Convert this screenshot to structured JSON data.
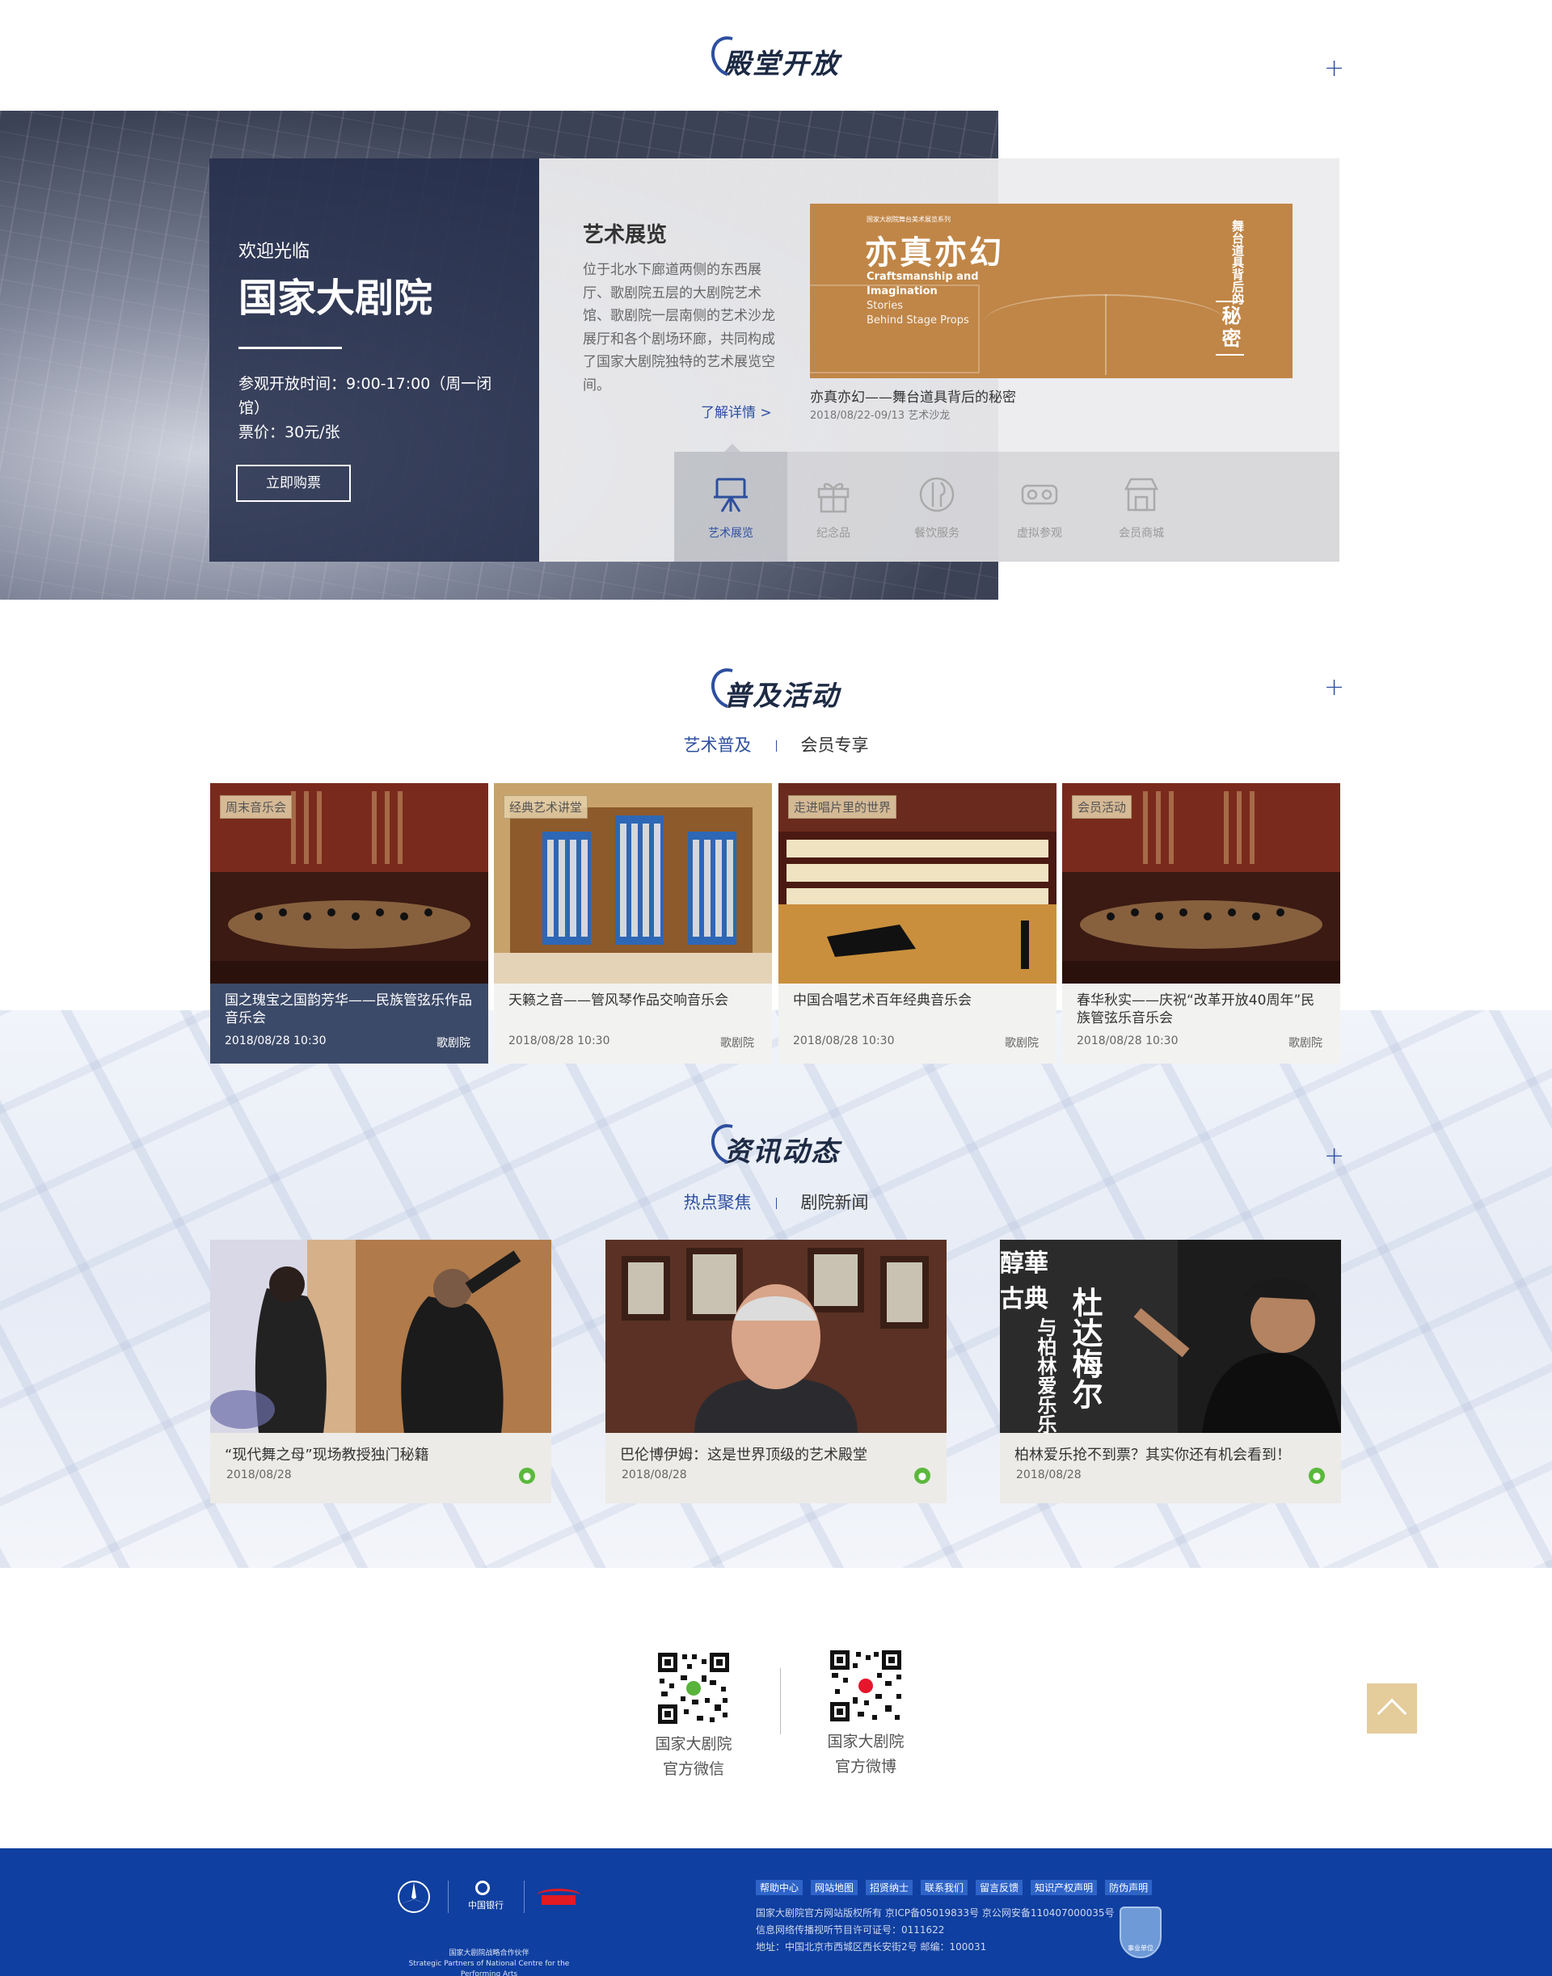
{
  "section_open": {
    "title": "殿堂开放",
    "plus": "+",
    "welcome": {
      "line1": "欢迎光临",
      "line2": "国家大剧院",
      "hours": "参观开放时间：9:00-17:00（周一闭馆）",
      "price": "票价：30元/张",
      "buy_button": "立即购票"
    },
    "exhibition": {
      "title": "艺术展览",
      "desc": "位于北水下廊道两侧的东西展厅、歌剧院五层的大剧院艺术馆、歌剧院一层南侧的艺术沙龙展厅和各个剧场环廊，共同构成了国家大剧院独特的艺术展览空间。",
      "more": "了解详情 >",
      "poster": {
        "top_small": "国家大剧院舞台美术展览系列",
        "big_title": "亦真亦幻",
        "en_line1": "Craftsmanship and",
        "en_line2": "Imagination",
        "en_line3": "Stories",
        "en_line4": "Behind Stage Props",
        "vertical_small": "舞台道具背后的",
        "vertical_big": "秘密"
      },
      "caption": "亦真亦幻——舞台道具背后的秘密",
      "caption_sub": "2018/08/22-09/13   艺术沙龙"
    },
    "icons": [
      {
        "label": "艺术展览",
        "icon": "easel-icon"
      },
      {
        "label": "纪念品",
        "icon": "gift-icon"
      },
      {
        "label": "餐饮服务",
        "icon": "dining-icon"
      },
      {
        "label": "虚拟参观",
        "icon": "vr-icon"
      },
      {
        "label": "会员商城",
        "icon": "shop-icon"
      }
    ]
  },
  "section_activity": {
    "title": "普及活动",
    "plus": "+",
    "tabs": [
      "艺术普及",
      "会员专享"
    ],
    "cards": [
      {
        "tag": "周末音乐会",
        "title": "国之瑰宝之国韵芳华——民族管弦乐作品音乐会",
        "date": "2018/08/28   10:30",
        "venue": "歌剧院"
      },
      {
        "tag": "经典艺术讲堂",
        "title": "天籁之音——管风琴作品交响音乐会",
        "date": "2018/08/28   10:30",
        "venue": "歌剧院"
      },
      {
        "tag": "走进唱片里的世界",
        "title": "中国合唱艺术百年经典音乐会",
        "date": "2018/08/28   10:30",
        "venue": "歌剧院"
      },
      {
        "tag": "会员活动",
        "title": "春华秋实——庆祝“改革开放40周年”民族管弦乐音乐会",
        "date": "2018/08/28   10:30",
        "venue": "歌剧院"
      }
    ]
  },
  "section_news": {
    "title": "资讯动态",
    "plus": "+",
    "tabs": [
      "热点聚焦",
      "剧院新闻"
    ],
    "cards": [
      {
        "title": "“现代舞之母”现场教授独门秘籍",
        "date": "2018/08/28"
      },
      {
        "title": "巴伦博伊姆：这是世界顶级的艺术殿堂",
        "date": "2018/08/28"
      },
      {
        "title": "柏林爱乐抢不到票？其实你还有机会看到！",
        "date": "2018/08/28"
      }
    ],
    "card3_poster_text": {
      "big": "杜达梅尔",
      "sub": "与柏林爱乐乐",
      "top": "醇華古典"
    }
  },
  "social": {
    "wechat": [
      "国家大剧院",
      "官方微信"
    ],
    "weibo": [
      "国家大剧院",
      "官方微博"
    ]
  },
  "footer": {
    "links": [
      "帮助中心",
      "网站地图",
      "招贤纳士",
      "联系我们",
      "留言反馈",
      "知识产权声明",
      "防伪声明"
    ],
    "lines": [
      "国家大剧院官方网站版权所有   京ICP备05019833号   京公网安备110407000035号",
      "信息网络传播视听节目许可证号：0111622",
      "地址：中国北京市西城区西长安街2号   邮编：100031"
    ],
    "partners_cn": "国家大剧院战略合作伙伴",
    "partners_en": "Strategic Partners of National Centre for the Performing Arts",
    "badge": "事业单位",
    "bank": "中国银行"
  },
  "colors": {
    "brand_blue": "#2e4f9f",
    "footer_blue": "#0f3fa0",
    "gold": "#c08647"
  }
}
